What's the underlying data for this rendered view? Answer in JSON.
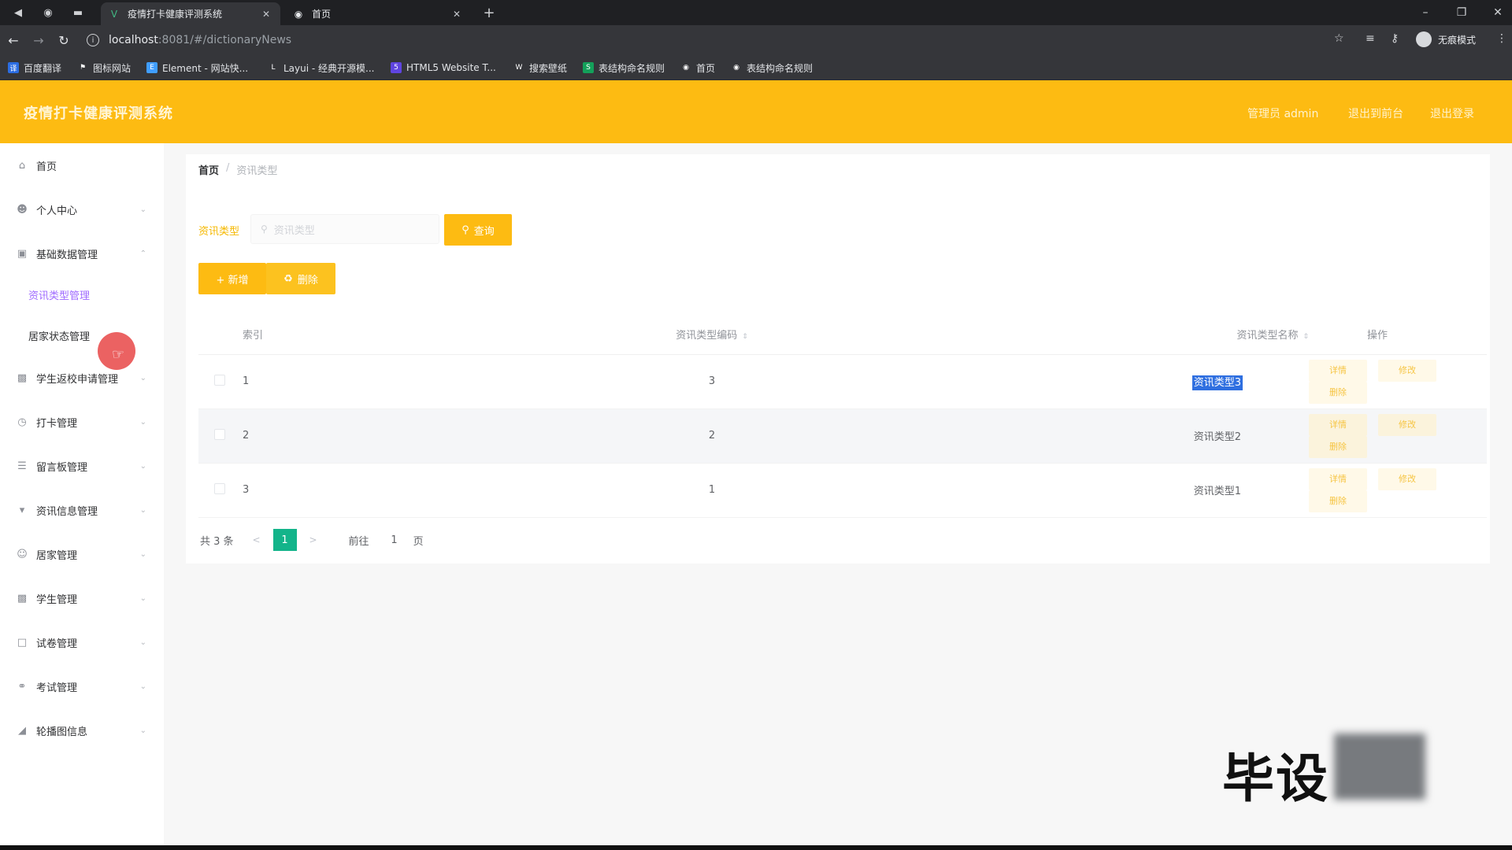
{
  "browser": {
    "tabs": [
      {
        "title": "疫情打卡健康评测系统",
        "favicon": "vue-icon",
        "active": true
      },
      {
        "title": "首页",
        "favicon": "globe-icon",
        "active": false
      }
    ],
    "new_tab_label": "+",
    "url_host": "localhost",
    "url_path": ":8081/#/dictionaryNews",
    "incognito_label": "无痕模式",
    "bookmarks": [
      {
        "label": "百度翻译",
        "icon": "baidu-translate-icon",
        "color": "#2b6de2"
      },
      {
        "label": "图标网站",
        "icon": "flag-icon",
        "color": "#35363a"
      },
      {
        "label": "Element - 网站快...",
        "icon": "element-icon",
        "color": "#409eff"
      },
      {
        "label": "Layui - 经典开源模...",
        "icon": "layui-icon",
        "color": "#35363a"
      },
      {
        "label": "HTML5 Website T...",
        "icon": "html5-icon",
        "color": "#5f45e0"
      },
      {
        "label": "搜索壁纸",
        "icon": "wallpaper-icon",
        "color": "#35363a"
      },
      {
        "label": "表结构命名规则",
        "icon": "sheet-icon",
        "color": "#14a05a"
      },
      {
        "label": "首页",
        "icon": "globe-icon",
        "color": "#35363a"
      },
      {
        "label": "表结构命名规则",
        "icon": "globe-icon",
        "color": "#35363a"
      }
    ]
  },
  "header": {
    "title": "疫情打卡健康评测系统",
    "user_label": "管理员 admin",
    "front_link": "退出到前台",
    "logout_link": "退出登录",
    "accent_color": "#fdbb12"
  },
  "sidebar": {
    "items": [
      {
        "label": "首页",
        "icon": "home-icon"
      },
      {
        "label": "个人中心",
        "icon": "user-icon"
      },
      {
        "label": "基础数据管理",
        "icon": "data-icon"
      },
      {
        "label": "学生返校申请管理",
        "icon": "bar-chart-icon"
      },
      {
        "label": "打卡管理",
        "icon": "clock-icon"
      },
      {
        "label": "留言板管理",
        "icon": "list-icon"
      },
      {
        "label": "资讯信息管理",
        "icon": "news-icon"
      },
      {
        "label": "居家管理",
        "icon": "person-icon"
      },
      {
        "label": "学生管理",
        "icon": "student-icon"
      },
      {
        "label": "试卷管理",
        "icon": "paper-icon"
      },
      {
        "label": "考试管理",
        "icon": "mic-icon"
      },
      {
        "label": "轮播图信息",
        "icon": "image-icon"
      }
    ],
    "sub_items": [
      {
        "label": "资讯类型管理",
        "active": true
      },
      {
        "label": "居家状态管理",
        "active": false
      }
    ]
  },
  "breadcrumb": {
    "home": "首页",
    "separator": "/",
    "current": "资讯类型"
  },
  "search": {
    "label": "资讯类型",
    "placeholder": "资讯类型",
    "button": "查询"
  },
  "actions": {
    "add": "+ 新增",
    "delete": "删除"
  },
  "table": {
    "columns": [
      "索引",
      "资讯类型编码",
      "资讯类型名称",
      "操作"
    ],
    "rows": [
      {
        "index": "1",
        "code": "3",
        "name": "资讯类型3",
        "selected_text": true
      },
      {
        "index": "2",
        "code": "2",
        "name": "资讯类型2",
        "selected_text": false
      },
      {
        "index": "3",
        "code": "1",
        "name": "资讯类型1",
        "selected_text": false
      }
    ],
    "row_actions": [
      "详情",
      "修改",
      "删除"
    ]
  },
  "pagination": {
    "total": "共 3 条",
    "prev": "<",
    "current_page": "1",
    "next": ">",
    "goto_label": "前往",
    "goto_value": "1",
    "page_suffix": "页",
    "active_color": "#13b48a"
  },
  "watermark": "毕设"
}
